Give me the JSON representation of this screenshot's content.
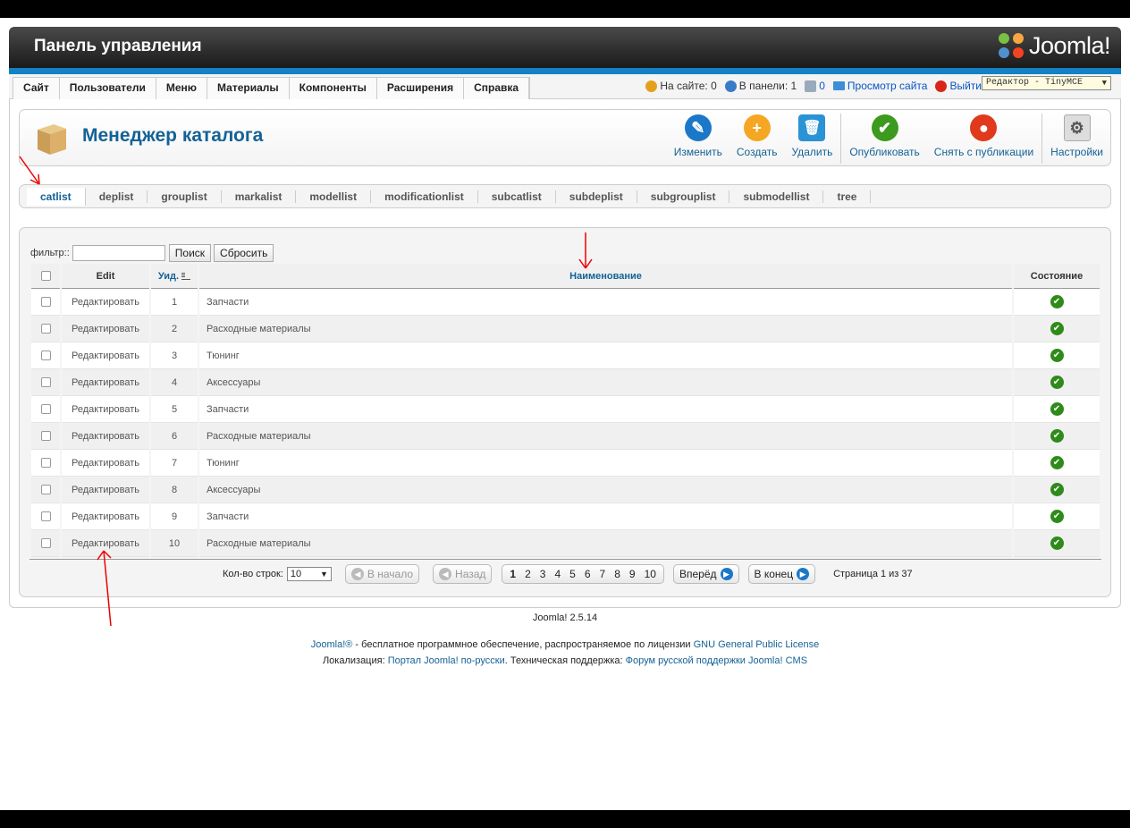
{
  "header": {
    "title": "Панель управления",
    "logo_text": "Joomla!"
  },
  "menu": [
    "Сайт",
    "Пользователи",
    "Меню",
    "Материалы",
    "Компоненты",
    "Расширения",
    "Справка"
  ],
  "status": {
    "on_site": "На сайте: 0",
    "in_panel": "В панели: 1",
    "messages": "0",
    "view_site": "Просмотр сайта",
    "logout": "Выйти",
    "editor": "Редактор - TinyMCE"
  },
  "toolbar": {
    "title": "Менеджер каталога",
    "buttons": [
      {
        "label": "Изменить",
        "icon": "pencil-icon",
        "color": "#1b78c8"
      },
      {
        "label": "Создать",
        "icon": "plus-icon",
        "color": "#f5a623"
      },
      {
        "label": "Удалить",
        "icon": "trash-icon",
        "color": "#2a93d5"
      },
      {
        "label": "Опубликовать",
        "icon": "check-icon",
        "color": "#3c9a1e"
      },
      {
        "label": "Снять с публикации",
        "icon": "unpublish-icon",
        "color": "#e0391c"
      },
      {
        "label": "Настройки",
        "icon": "options-icon",
        "color": "#888888"
      }
    ]
  },
  "subnav": [
    "catlist",
    "deplist",
    "grouplist",
    "markalist",
    "modellist",
    "modificationlist",
    "subcatlist",
    "subdeplist",
    "subgrouplist",
    "submodellist",
    "tree"
  ],
  "filter": {
    "label": "фильтр::",
    "value": "",
    "search": "Поиск",
    "reset": "Сбросить"
  },
  "table": {
    "headers": {
      "edit": "Edit",
      "id": "Уид.",
      "name": "Наименование",
      "state": "Состояние"
    },
    "edit_label": "Редактировать",
    "rows": [
      {
        "id": "1",
        "name": "Запчасти"
      },
      {
        "id": "2",
        "name": "Расходные материалы"
      },
      {
        "id": "3",
        "name": "Тюнинг"
      },
      {
        "id": "4",
        "name": "Аксессуары"
      },
      {
        "id": "5",
        "name": "Запчасти"
      },
      {
        "id": "6",
        "name": "Расходные материалы"
      },
      {
        "id": "7",
        "name": "Тюнинг"
      },
      {
        "id": "8",
        "name": "Аксессуары"
      },
      {
        "id": "9",
        "name": "Запчасти"
      },
      {
        "id": "10",
        "name": "Расходные материалы"
      }
    ]
  },
  "pagination": {
    "rows_label": "Кол-во строк:",
    "rows_value": "10",
    "start": "В начало",
    "prev": "Назад",
    "pages": [
      "1",
      "2",
      "3",
      "4",
      "5",
      "6",
      "7",
      "8",
      "9",
      "10"
    ],
    "next": "Вперёд",
    "end": "В конец",
    "info": "Страница 1 из 37"
  },
  "footer": {
    "version": "Joomla! 2.5.14",
    "joomla_link": "Joomla!®",
    "line1_text": " - бесплатное программное обеспечение, распространяемое по лицензии ",
    "license": "GNU General Public License",
    "loc_label": "Локализация: ",
    "loc_link": "Портал Joomla! по-русски",
    "support_label": ". Техническая поддержка: ",
    "support_link": "Форум русской поддержки Joomla! CMS"
  }
}
